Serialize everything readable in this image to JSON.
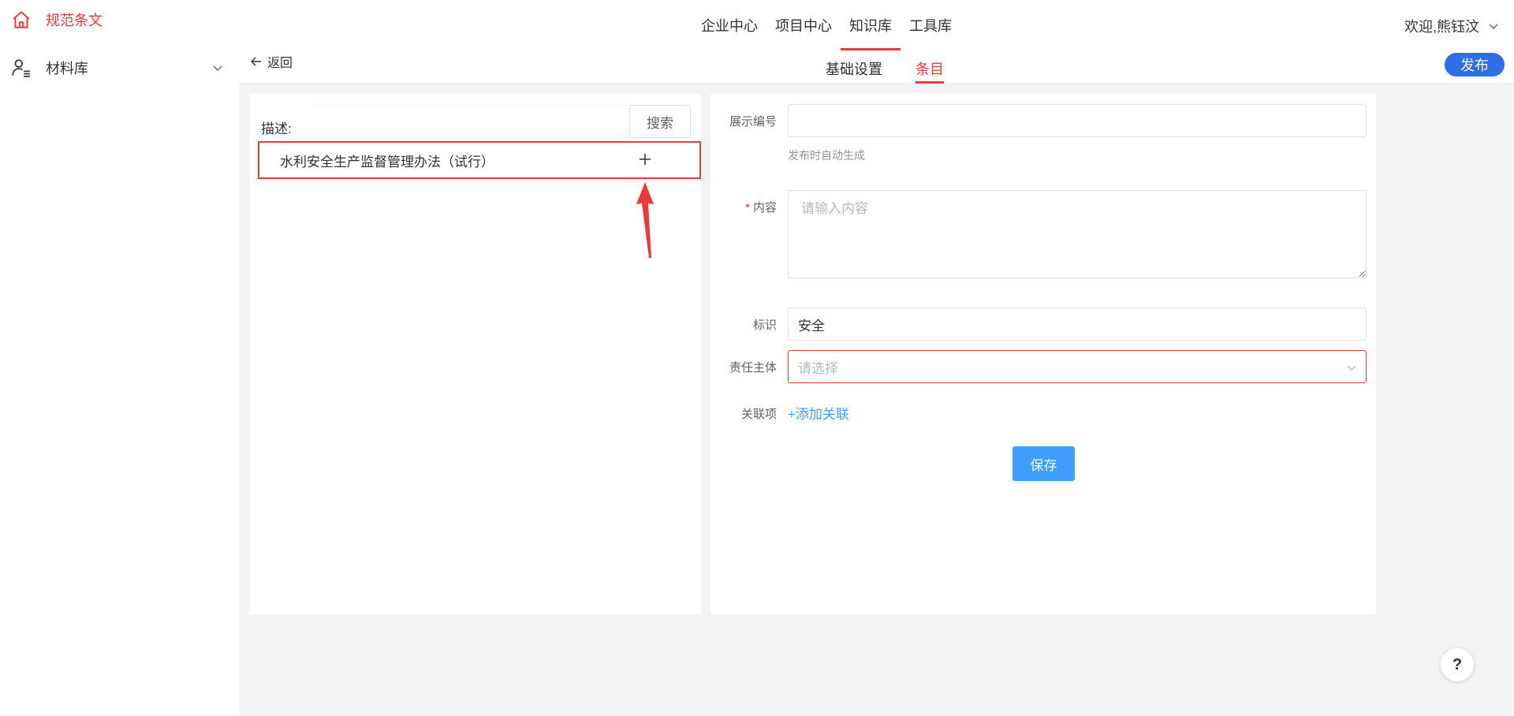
{
  "sidebar": {
    "brand": "规范条文",
    "items": [
      {
        "label": "材料库",
        "icon": "user-list-icon"
      }
    ]
  },
  "topnav": {
    "items": [
      {
        "label": "企业中心",
        "active": false
      },
      {
        "label": "项目中心",
        "active": false
      },
      {
        "label": "知识库",
        "active": true
      },
      {
        "label": "工具库",
        "active": false
      }
    ],
    "welcome": "欢迎,熊钰汶"
  },
  "subheader": {
    "back_label": "返回",
    "tabs": [
      {
        "label": "基础设置",
        "active": false
      },
      {
        "label": "条目",
        "active": true
      }
    ],
    "publish_label": "发布"
  },
  "left_panel": {
    "desc_label": "描述:",
    "search_value": "",
    "search_button": "搜索",
    "items": [
      {
        "label": "水利安全生产监督管理办法（试行）"
      }
    ]
  },
  "form": {
    "display_no": {
      "label": "展示编号",
      "value": "",
      "hint": "发布时自动生成"
    },
    "content": {
      "label": "内容",
      "required_mark": "*",
      "placeholder": "请输入内容"
    },
    "tag": {
      "label": "标识",
      "value": "安全"
    },
    "responsible": {
      "label": "责任主体",
      "placeholder": "请选择"
    },
    "relation": {
      "label": "关联项",
      "add_link": "+添加关联"
    },
    "save_label": "保存"
  },
  "help_label": "?",
  "colors": {
    "accent": "#e8393b",
    "primary": "#409eff",
    "publish": "#2f6fe4"
  }
}
